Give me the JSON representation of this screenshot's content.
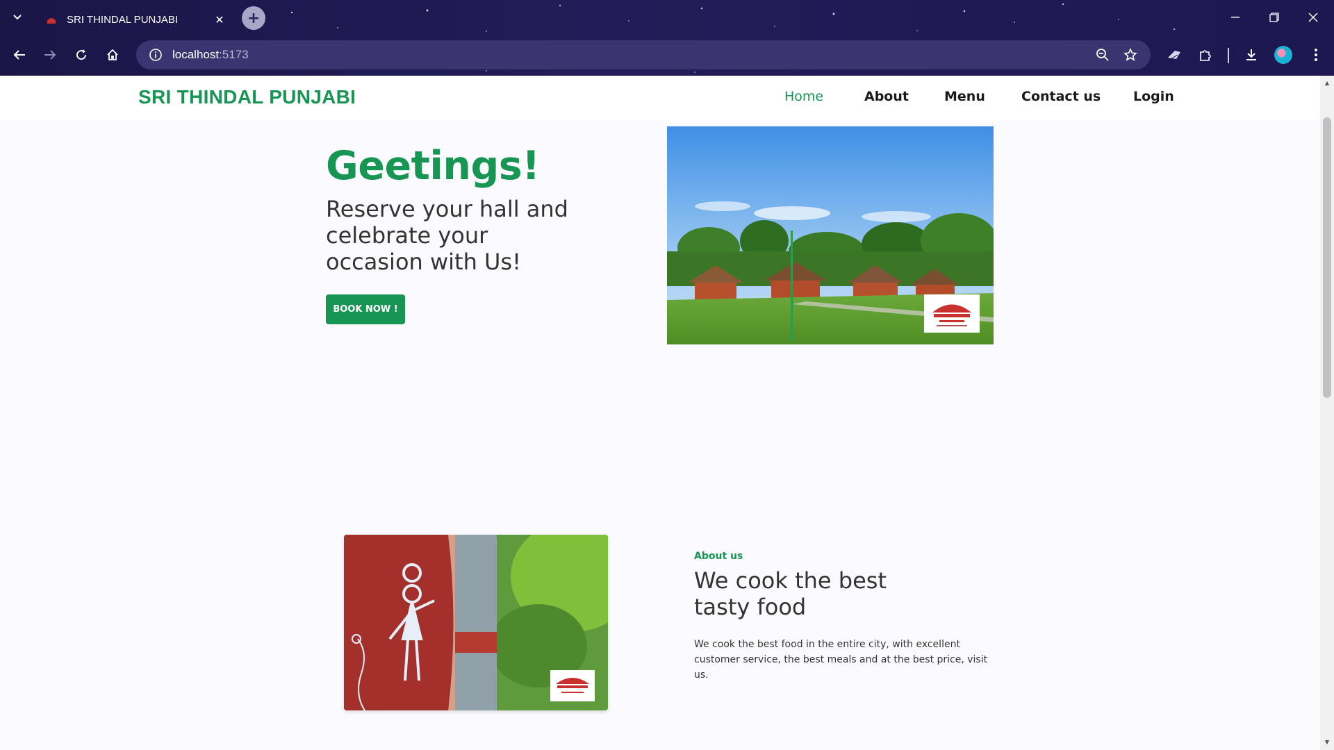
{
  "browser": {
    "tab_title": "SRI THINDAL PUNJABI",
    "url_host": "localhost",
    "url_port": ":5173"
  },
  "site": {
    "brand": "SRI THINDAL PUNJABI",
    "nav": [
      {
        "label": "Home",
        "active": true
      },
      {
        "label": "About",
        "active": false
      },
      {
        "label": "Menu",
        "active": false
      },
      {
        "label": "Contact us",
        "active": false
      },
      {
        "label": "Login",
        "active": false
      }
    ]
  },
  "hero": {
    "greeting": "Geetings!",
    "subtitle": "Reserve your hall and celebrate your occasion with Us!",
    "button": "BOOK NOW !"
  },
  "about": {
    "kicker": "About us",
    "title": "We cook the best tasty food",
    "text": "We cook the best food in the entire city, with excellent customer service, the best meals and at the best price, visit us."
  },
  "colors": {
    "accent": "#179553",
    "chrome_bg": "#1f1a4d",
    "page_bg": "#fbfbff"
  }
}
